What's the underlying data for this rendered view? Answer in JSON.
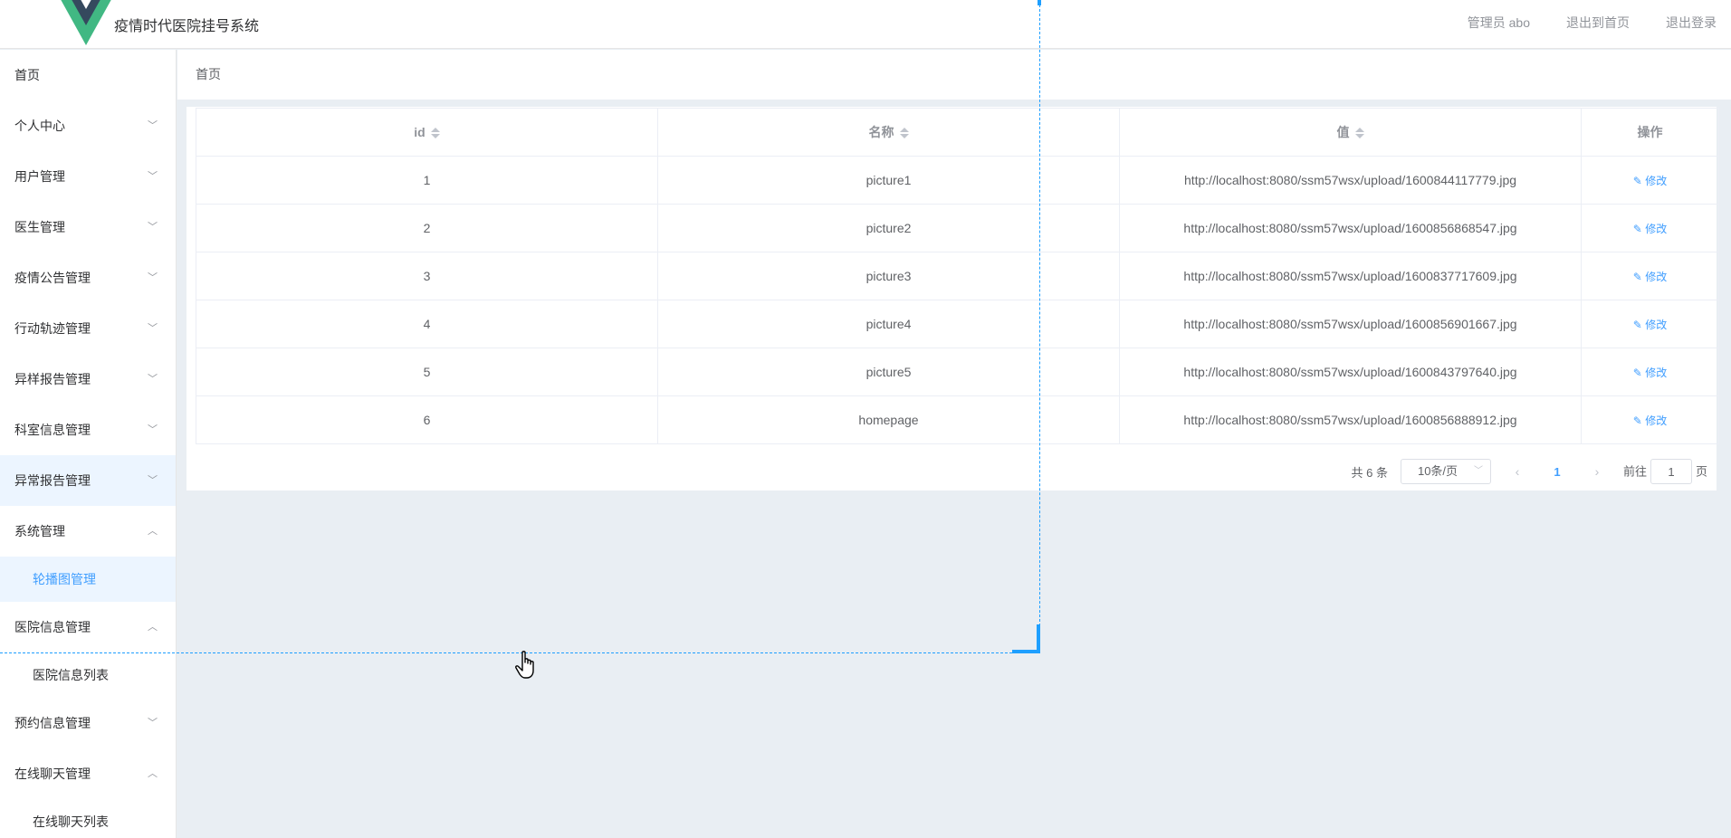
{
  "header": {
    "title": "疫情时代医院挂号系统",
    "admin": "管理员 abo",
    "exit_home": "退出到首页",
    "logout": "退出登录"
  },
  "sidebar": {
    "home": "首页",
    "items": [
      {
        "label": "个人中心",
        "chev": "chevron-down"
      },
      {
        "label": "用户管理",
        "chev": "chevron-down"
      },
      {
        "label": "医生管理",
        "chev": "chevron-down"
      },
      {
        "label": "疫情公告管理",
        "chev": "chevron-down"
      },
      {
        "label": "行动轨迹管理",
        "chev": "chevron-down"
      },
      {
        "label": "异样报告管理",
        "chev": "chevron-down"
      },
      {
        "label": "科室信息管理",
        "chev": "chevron-down"
      },
      {
        "label": "异常报告管理",
        "chev": "chevron-down"
      },
      {
        "label": "系统管理",
        "chev": "chevron-up"
      },
      {
        "label": "医院信息管理",
        "chev": "chevron-up"
      },
      {
        "label": "预约信息管理",
        "chev": "chevron-down"
      },
      {
        "label": "在线聊天管理",
        "chev": "chevron-up"
      }
    ],
    "sub_carousel": "轮播图管理",
    "sub_hospital_list": "医院信息列表",
    "sub_chat_list": "在线聊天列表"
  },
  "breadcrumb": "首页",
  "table": {
    "headers": [
      "id",
      "名称",
      "值",
      "操作"
    ],
    "edit_label": "修改",
    "rows": [
      {
        "id": "1",
        "name": "picture1",
        "value": "http://localhost:8080/ssm57wsx/upload/1600844117779.jpg"
      },
      {
        "id": "2",
        "name": "picture2",
        "value": "http://localhost:8080/ssm57wsx/upload/1600856868547.jpg"
      },
      {
        "id": "3",
        "name": "picture3",
        "value": "http://localhost:8080/ssm57wsx/upload/1600837717609.jpg"
      },
      {
        "id": "4",
        "name": "picture4",
        "value": "http://localhost:8080/ssm57wsx/upload/1600856901667.jpg"
      },
      {
        "id": "5",
        "name": "picture5",
        "value": "http://localhost:8080/ssm57wsx/upload/1600843797640.jpg"
      },
      {
        "id": "6",
        "name": "homepage",
        "value": "http://localhost:8080/ssm57wsx/upload/1600856888912.jpg"
      }
    ]
  },
  "pagination": {
    "total": "共 6 条",
    "page_size": "10条/页",
    "current": "1",
    "goto_prefix": "前往",
    "goto_value": "1",
    "goto_suffix": "页"
  },
  "colors": {
    "accent": "#409eff",
    "guide": "#1e9fff",
    "logo_dark": "#35495e",
    "logo_green": "#41b883"
  }
}
